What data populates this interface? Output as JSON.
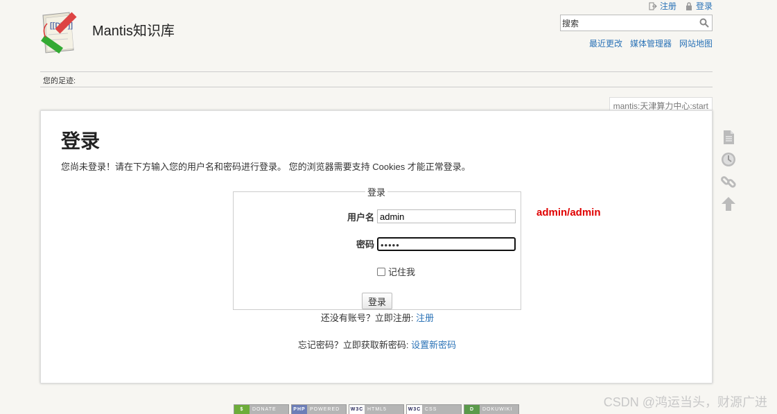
{
  "header": {
    "site_title": "Mantis知识库",
    "user_tools": [
      {
        "label": "注册",
        "icon": "register-icon"
      },
      {
        "label": "登录",
        "icon": "lock-icon"
      }
    ],
    "search": {
      "value": "搜索"
    },
    "site_tools": [
      "最近更改",
      "媒体管理器",
      "网站地图"
    ]
  },
  "breadcrumb": "您的足迹:",
  "page_id": "mantis:天津算力中心:start",
  "login": {
    "title": "登录",
    "intro": "您尚未登录！请在下方输入您的用户名和密码进行登录。 您的浏览器需要支持 Cookies 才能正常登录。",
    "legend": "登录",
    "username_label": "用户名",
    "username_value": "admin",
    "password_label": "密码",
    "password_value": "•••••",
    "remember_label": "记住我",
    "submit_label": "登录",
    "register_text": "还没有账号？立即注册: ",
    "register_link": "注册",
    "forgot_text": "忘记密码？立即获取新密码: ",
    "forgot_link": "设置新密码",
    "hint": "admin/admin"
  },
  "page_tools": [
    "page-icon",
    "history-icon",
    "backlinks-icon",
    "top-icon"
  ],
  "badges": [
    {
      "icon": "$",
      "label": "DONATE",
      "color": "#6dad3a"
    },
    {
      "icon": "PHP",
      "label": "POWERED",
      "color": "#6c7eb7"
    },
    {
      "icon": "W3C",
      "label": "HTML5",
      "color": "#ffffff"
    },
    {
      "icon": "W3C",
      "label": "CSS",
      "color": "#ffffff"
    },
    {
      "icon": "D",
      "label": "DOKUWIKI",
      "color": "#5a9a4a"
    }
  ],
  "watermark": "CSDN @鸿运当头，财源广进",
  "colors": {
    "link": "#2b73b7",
    "hint": "#e00000",
    "background": "#f7f6f2"
  }
}
